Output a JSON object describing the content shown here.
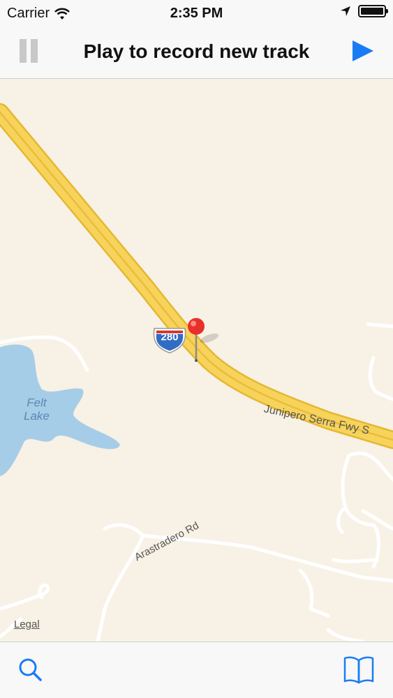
{
  "status_bar": {
    "carrier": "Carrier",
    "time": "2:35 PM",
    "icons": [
      "wifi-icon",
      "location-arrow-icon",
      "battery-icon"
    ]
  },
  "nav_bar": {
    "title": "Play to record new track",
    "left_button_icon": "pause-icon",
    "right_button_icon": "play-icon",
    "accent_color": "#1a7cf5"
  },
  "map": {
    "highway_shield": "280",
    "road_label_main": "Junipero Serra Fwy S",
    "road_label_secondary": "Arastradero Rd",
    "lake_label_line1": "Felt",
    "lake_label_line2": "Lake",
    "legal_link": "Legal",
    "pin_icon": "map-pin-icon"
  },
  "tab_bar": {
    "left_icon": "search-icon",
    "right_icon": "book-icon"
  }
}
